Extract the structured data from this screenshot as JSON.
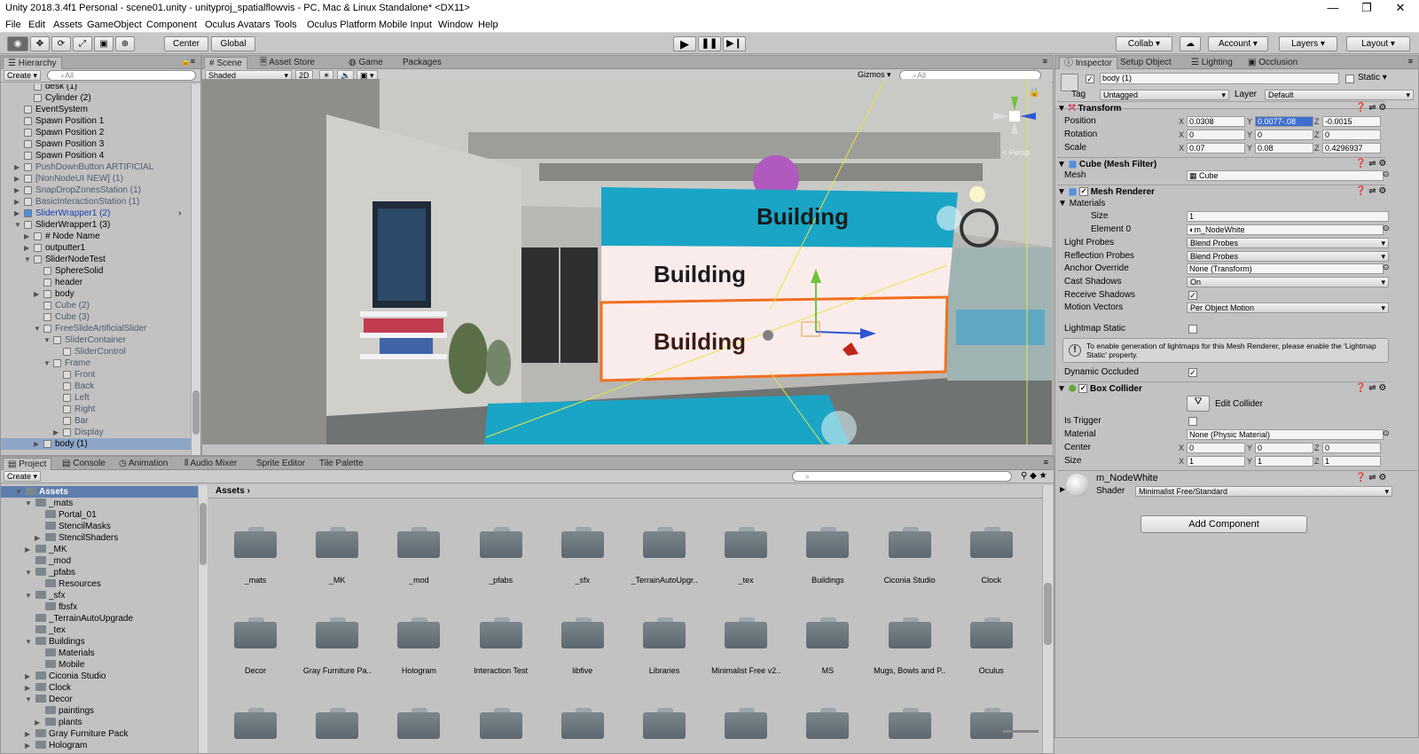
{
  "window": {
    "title": "Unity 2018.3.4f1 Personal - scene01.unity - unityproj_spatialflowvis - PC, Mac & Linux Standalone* <DX11>",
    "minimize": "—",
    "maximize": "❐",
    "close": "✕"
  },
  "menu": [
    "File",
    "Edit",
    "Assets",
    "GameObject",
    "Component",
    "Oculus Avatars",
    "Tools",
    "Oculus Platform",
    "Mobile Input",
    "Window",
    "Help"
  ],
  "toolbar": {
    "pivot": "Center",
    "space": "Global",
    "collab": "Collab",
    "account": "Account",
    "layers": "Layers",
    "layout": "Layout",
    "play_icon": "play-icon",
    "pause_icon": "pause-icon",
    "step_icon": "step-icon"
  },
  "hierarchy": {
    "tab": "Hierarchy",
    "create": "Create",
    "search_placeholder": "All",
    "rows": [
      {
        "label": "desk (1)",
        "indent": 2,
        "arrow": ""
      },
      {
        "label": "Cylinder (2)",
        "indent": 2,
        "arrow": ""
      },
      {
        "label": "EventSystem",
        "indent": 1,
        "arrow": ""
      },
      {
        "label": "Spawn Position 1",
        "indent": 1,
        "arrow": ""
      },
      {
        "label": "Spawn Position 2",
        "indent": 1,
        "arrow": ""
      },
      {
        "label": "Spawn Position 3",
        "indent": 1,
        "arrow": ""
      },
      {
        "label": "Spawn Position 4",
        "indent": 1,
        "arrow": ""
      },
      {
        "label": "PushDownButton ARTIFICIAL",
        "indent": 1,
        "arrow": "▶",
        "dim": true
      },
      {
        "label": "[NonNodeUI NEW] (1)",
        "indent": 1,
        "arrow": "▶",
        "dim": true
      },
      {
        "label": "SnapDropZonesStation (1)",
        "indent": 1,
        "arrow": "▶",
        "dim": true
      },
      {
        "label": "BasicInteractionStation (1)",
        "indent": 1,
        "arrow": "▶",
        "dim": true
      },
      {
        "label": "SliderWrapper1 (2)",
        "indent": 1,
        "arrow": "▶",
        "blue": true
      },
      {
        "label": "SliderWrapper1 (3)",
        "indent": 1,
        "arrow": "▼"
      },
      {
        "label": "# Node Name",
        "indent": 2,
        "arrow": "▶"
      },
      {
        "label": "outputter1",
        "indent": 2,
        "arrow": "▶"
      },
      {
        "label": "SliderNodeTest",
        "indent": 2,
        "arrow": "▼"
      },
      {
        "label": "SphereSolid",
        "indent": 3,
        "arrow": ""
      },
      {
        "label": "header",
        "indent": 3,
        "arrow": ""
      },
      {
        "label": "body",
        "indent": 3,
        "arrow": "▶"
      },
      {
        "label": "Cube (2)",
        "indent": 3,
        "arrow": "",
        "dim": true
      },
      {
        "label": "Cube (3)",
        "indent": 3,
        "arrow": "",
        "dim": true
      },
      {
        "label": "FreeSlideArtificialSlider",
        "indent": 3,
        "arrow": "▼",
        "dim": true
      },
      {
        "label": "SliderContainer",
        "indent": 4,
        "arrow": "▼",
        "dim": true
      },
      {
        "label": "SliderControl",
        "indent": 5,
        "arrow": "",
        "dim": true
      },
      {
        "label": "Frame",
        "indent": 4,
        "arrow": "▼",
        "dim": true
      },
      {
        "label": "Front",
        "indent": 5,
        "arrow": "",
        "dim": true
      },
      {
        "label": "Back",
        "indent": 5,
        "arrow": "",
        "dim": true
      },
      {
        "label": "Left",
        "indent": 5,
        "arrow": "",
        "dim": true
      },
      {
        "label": "Right",
        "indent": 5,
        "arrow": "",
        "dim": true
      },
      {
        "label": "Bar",
        "indent": 5,
        "arrow": "",
        "dim": true
      },
      {
        "label": "Display",
        "indent": 5,
        "arrow": "▶",
        "dim": true
      },
      {
        "label": "body (1)",
        "indent": 3,
        "arrow": "▶",
        "selected": true
      }
    ]
  },
  "scene_tabs": [
    "Scene",
    "Asset Store",
    "Game",
    "Packages"
  ],
  "scene_bar": {
    "shading": "Shaded",
    "mode2d": "2D",
    "gizmos": "Gizmos",
    "search_placeholder": "All",
    "persp": "< Persp"
  },
  "scene": {
    "panel1": "Building",
    "panel2": "Building",
    "panel3": "Building"
  },
  "inspector": {
    "tabs": [
      "Inspector",
      "Setup Object",
      "Lighting",
      "Occlusion"
    ],
    "object_name": "body (1)",
    "static": "Static",
    "tag_label": "Tag",
    "tag": "Untagged",
    "layer_label": "Layer",
    "layer": "Default",
    "transform": {
      "title": "Transform",
      "position": {
        "label": "Position",
        "x": "0.0308",
        "y": "0.0077-.08",
        "z": "-0.0015"
      },
      "rotation": {
        "label": "Rotation",
        "x": "0",
        "y": "0",
        "z": "0"
      },
      "scale": {
        "label": "Scale",
        "x": "0.07",
        "y": "0.08",
        "z": "0.4296937"
      }
    },
    "mesh_filter": {
      "title": "Cube (Mesh Filter)",
      "mesh_label": "Mesh",
      "mesh": "Cube"
    },
    "mesh_renderer": {
      "title": "Mesh Renderer",
      "materials": "Materials",
      "size_label": "Size",
      "size": "1",
      "element0_label": "Element 0",
      "element0": "m_NodeWhite",
      "light_probes_label": "Light Probes",
      "light_probes": "Blend Probes",
      "reflection_probes_label": "Reflection Probes",
      "reflection_probes": "Blend Probes",
      "anchor_label": "Anchor Override",
      "anchor": "None (Transform)",
      "cast_label": "Cast Shadows",
      "cast": "On",
      "receive_label": "Receive Shadows",
      "motion_label": "Motion Vectors",
      "motion": "Per Object Motion",
      "lightmap_label": "Lightmap Static",
      "info": "To enable generation of lightmaps for this Mesh Renderer, please enable the 'Lightmap Static' property.",
      "dynamic_label": "Dynamic Occluded"
    },
    "box_collider": {
      "title": "Box Collider",
      "edit": "Edit Collider",
      "trigger_label": "Is Trigger",
      "material_label": "Material",
      "material": "None (Physic Material)",
      "center_label": "Center",
      "center": {
        "x": "0",
        "y": "0",
        "z": "0"
      },
      "size_label": "Size",
      "size": {
        "x": "1",
        "y": "1",
        "z": "1"
      }
    },
    "material": {
      "name": "m_NodeWhite",
      "shader_label": "Shader",
      "shader": "Minimalist Free/Standard"
    },
    "add_component": "Add Component"
  },
  "bottom_tabs": [
    "Project",
    "Console",
    "Animation",
    "Audio Mixer",
    "Sprite Editor",
    "Tile Palette"
  ],
  "project": {
    "create": "Create",
    "breadcrumb": "Assets",
    "tree": [
      {
        "label": "Assets",
        "indent": 0,
        "arrow": "▼",
        "selected": true
      },
      {
        "label": "_mats",
        "indent": 1,
        "arrow": "▼"
      },
      {
        "label": "Portal_01",
        "indent": 2,
        "arrow": ""
      },
      {
        "label": "StencilMasks",
        "indent": 2,
        "arrow": ""
      },
      {
        "label": "StencilShaders",
        "indent": 2,
        "arrow": "▶"
      },
      {
        "label": "_MK",
        "indent": 1,
        "arrow": "▶"
      },
      {
        "label": "_mod",
        "indent": 1,
        "arrow": ""
      },
      {
        "label": "_pfabs",
        "indent": 1,
        "arrow": "▼"
      },
      {
        "label": "Resources",
        "indent": 2,
        "arrow": ""
      },
      {
        "label": "_sfx",
        "indent": 1,
        "arrow": "▼"
      },
      {
        "label": "fbsfx",
        "indent": 2,
        "arrow": ""
      },
      {
        "label": "_TerrainAutoUpgrade",
        "indent": 1,
        "arrow": ""
      },
      {
        "label": "_tex",
        "indent": 1,
        "arrow": ""
      },
      {
        "label": "Buildings",
        "indent": 1,
        "arrow": "▼"
      },
      {
        "label": "Materials",
        "indent": 2,
        "arrow": ""
      },
      {
        "label": "Mobile",
        "indent": 2,
        "arrow": ""
      },
      {
        "label": "Ciconia Studio",
        "indent": 1,
        "arrow": "▶"
      },
      {
        "label": "Clock",
        "indent": 1,
        "arrow": "▶"
      },
      {
        "label": "Decor",
        "indent": 1,
        "arrow": "▼"
      },
      {
        "label": "paintings",
        "indent": 2,
        "arrow": ""
      },
      {
        "label": "plants",
        "indent": 2,
        "arrow": "▶"
      },
      {
        "label": "Gray Furniture Pack",
        "indent": 1,
        "arrow": "▶"
      },
      {
        "label": "Hologram",
        "indent": 1,
        "arrow": "▶"
      }
    ],
    "folders_row1": [
      "_mats",
      "_MK",
      "_mod",
      "_pfabs",
      "_sfx",
      "_TerrainAutoUpgr..",
      "_tex",
      "Buildings",
      "Ciconia Studio",
      "Clock"
    ],
    "folders_row2": [
      "Decor",
      "Gray Furniture Pa..",
      "Hologram",
      "Interaction Test",
      "libfive",
      "Libraries",
      "Minimalist Free v2..",
      "MS",
      "Mugs, Bowls and P..",
      "Oculus"
    ],
    "folders_row3": [
      "",
      "",
      "",
      "",
      "",
      "",
      "",
      "",
      "",
      ""
    ]
  }
}
